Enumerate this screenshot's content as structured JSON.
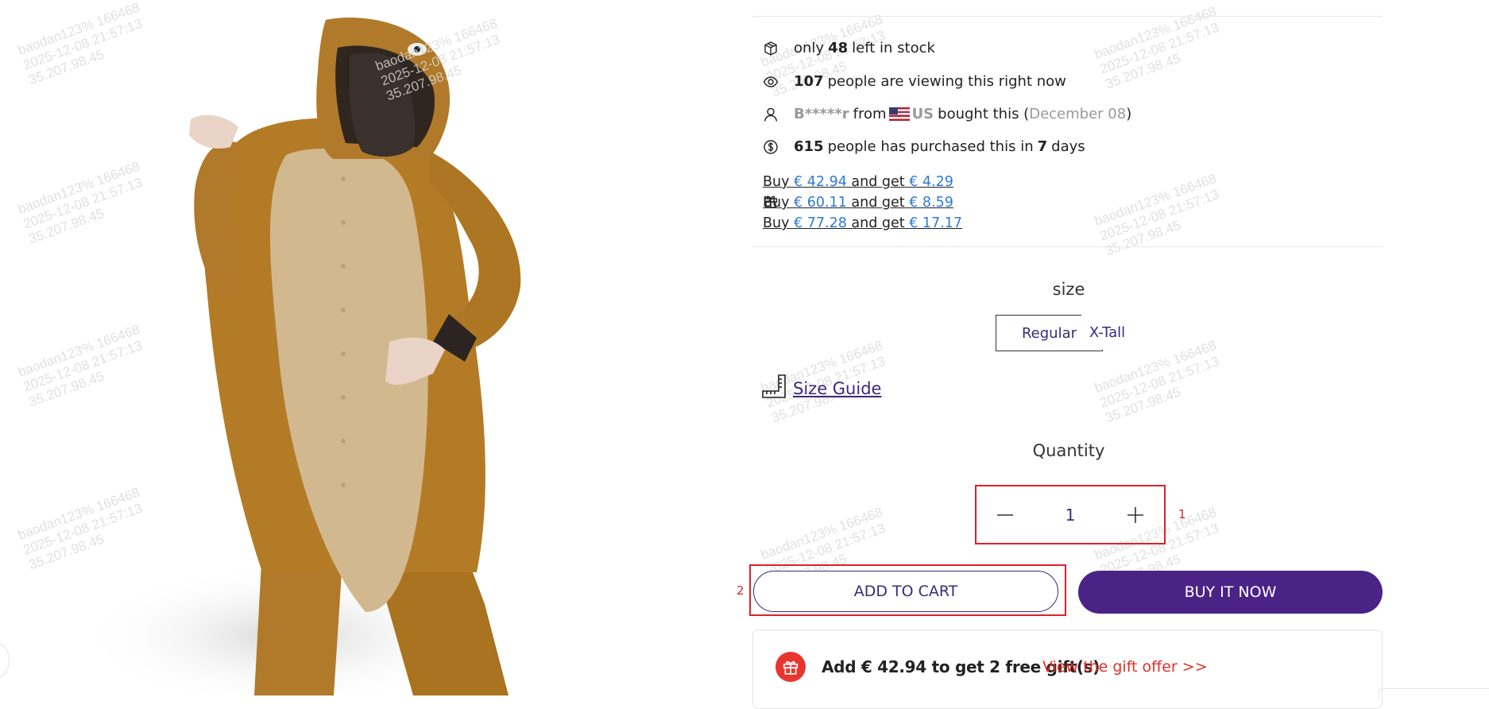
{
  "product": {
    "image_alt": "Platypus onesie costume"
  },
  "watermark": {
    "lines": "baodan123% 166468\n2025-12-08 21:57:13\n35.207.98.45"
  },
  "stock": {
    "prefix": "only",
    "count": "48",
    "suffix": "left in stock"
  },
  "viewers": {
    "count": "107",
    "text": "people are viewing this right now"
  },
  "recent_purchase": {
    "buyer": "B*****r",
    "from": "from",
    "country": "US",
    "action": "bought this (",
    "date": "December 08",
    "close": ")"
  },
  "purchases": {
    "count": "615",
    "text": "people has purchased this in",
    "days": "7",
    "unit": "days"
  },
  "offers": [
    {
      "buy": "Buy",
      "spend": "€ 42.94",
      "and_get": "and get",
      "get": "€ 4.29"
    },
    {
      "buy": "Buy",
      "spend": "€ 60.11",
      "and_get": "and get",
      "get": "€ 8.59"
    },
    {
      "buy": "Buy",
      "spend": "€ 77.28",
      "and_get": "and get",
      "get": "€ 17.17"
    }
  ],
  "size": {
    "title": "size",
    "options": [
      "Regular",
      "X-Tall"
    ],
    "selected": "Regular"
  },
  "size_guide": {
    "label": "Size Guide"
  },
  "quantity": {
    "title": "Quantity",
    "value": "1",
    "tag": "1"
  },
  "buttons": {
    "add_to_cart": "ADD TO CART",
    "add_to_cart_tag": "2",
    "buy_now": "BUY IT NOW"
  },
  "gift_offer": {
    "text": "Add € 42.94 to get 2 free gift(s)",
    "link": "View the gift offer >>"
  },
  "colors": {
    "accent": "#4b2387",
    "link_blue": "#2d7ad6",
    "highlight_red": "#e0202a",
    "gift_red": "#e8362e"
  }
}
